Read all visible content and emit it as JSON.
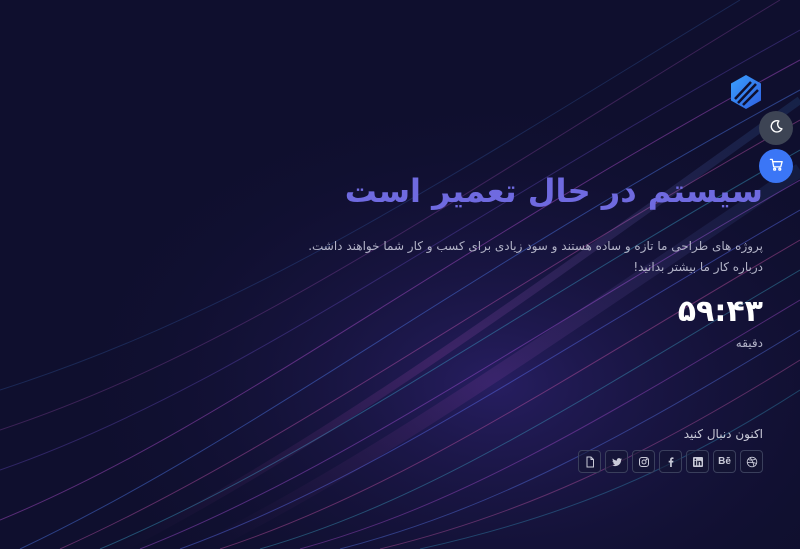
{
  "title": "سیستم در حال تعمیر است",
  "description": "پروژه های طراحی ما تازه و ساده هستند و سود زیادی برای کسب و کار شما خواهند داشت. درباره کار ما بیشتر بدانید!",
  "countdown": {
    "value": "۵۹:۴۳",
    "label": "دقیقه"
  },
  "follow_label": "اکنون دنبال کنید",
  "colors": {
    "background": "#0f0f2e",
    "accent": "#3b76f6",
    "title": "#6f6ae0"
  },
  "icons": {
    "logo": "hexagon-stripes-logo",
    "theme_toggle": "moon-icon",
    "cart": "cart-icon",
    "socials": [
      "dribbble-icon",
      "behance-icon",
      "linkedin-icon",
      "facebook-icon",
      "instagram-icon",
      "twitter-icon",
      "file-icon"
    ]
  },
  "socials": {
    "behance_text": "Bē"
  }
}
